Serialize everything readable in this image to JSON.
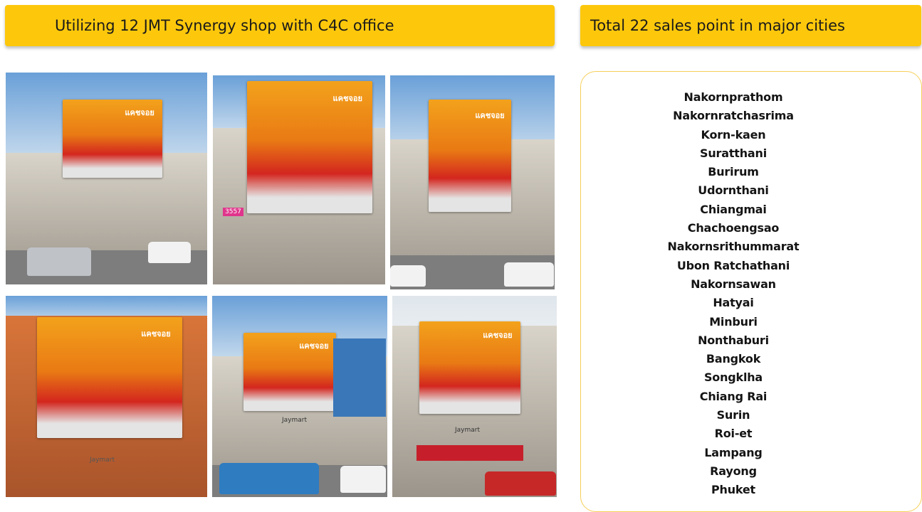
{
  "left_banner": {
    "title": "Utilizing 12 JMT Synergy shop with C4C office"
  },
  "right_banner": {
    "title": "Total  22 sales point in major cities"
  },
  "photos": [
    {
      "sign_text": "แคชจอย"
    },
    {
      "sign_text": "แคชจอย",
      "phone_text": "3557"
    },
    {
      "sign_text": "แคชจอย"
    },
    {
      "sign_text": "แคชจอย",
      "shop_text": "Jaymart"
    },
    {
      "sign_text": "แคชจอย",
      "shop_text": "Jaymart"
    },
    {
      "sign_text": "แคชจอย",
      "shop_text": "Jaymart"
    }
  ],
  "cities": [
    "Nakornprathom",
    "Nakornratchasrima",
    "Korn-kaen",
    "Suratthani",
    "Burirum",
    "Udornthani",
    "Chiangmai",
    "Chachoengsao",
    "Nakornsrithummarat",
    "Ubon Ratchathani",
    "Nakornsawan",
    "Hatyai",
    "Minburi",
    "Nonthaburi",
    "Bangkok",
    "Songklha",
    "Chiang Rai",
    "Surin",
    "Roi-et",
    "Lampang",
    "Rayong",
    "Phuket"
  ],
  "colors": {
    "banner": "#fdc80c",
    "box_border": "#f6cf58"
  }
}
